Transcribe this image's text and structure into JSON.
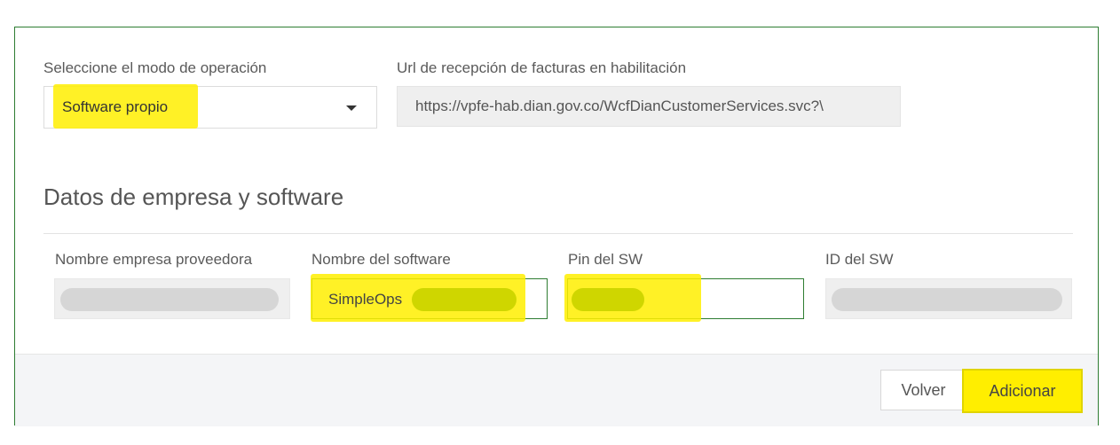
{
  "operation": {
    "label": "Seleccione el modo de operación",
    "selected": "Software propio"
  },
  "url": {
    "label": "Url de recepción de facturas en habilitación",
    "value": "https://vpfe-hab.dian.gov.co/WcfDianCustomerServices.svc?\\"
  },
  "section": {
    "title": "Datos de empresa y software"
  },
  "fields": {
    "provider_label": "Nombre empresa proveedora",
    "software_label": "Nombre del software",
    "software_value": "SimpleOps",
    "pin_label": "Pin del SW",
    "id_label": "ID del SW"
  },
  "footer": {
    "back_label": "Volver",
    "add_label": "Adicionar"
  },
  "colors": {
    "border_green": "#2e7d32",
    "highlight": "#ffee00"
  }
}
